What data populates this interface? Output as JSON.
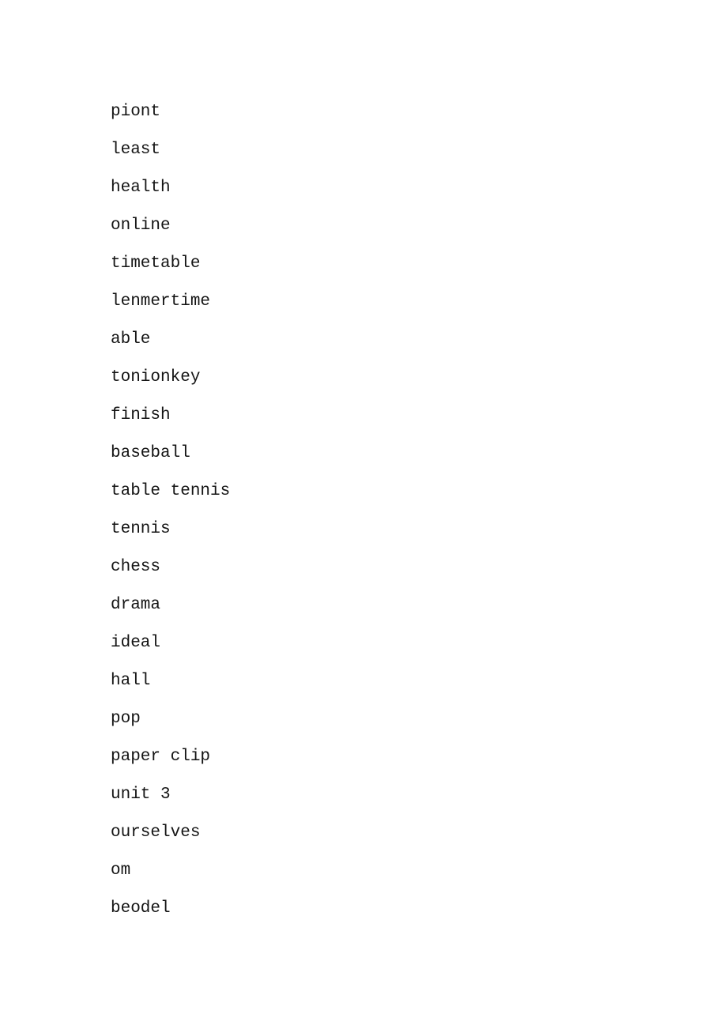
{
  "document": {
    "page_background": "#ffffff",
    "text_color": "#141414",
    "word_list": [
      {
        "text": "piont"
      },
      {
        "text": "least"
      },
      {
        "text": "health"
      },
      {
        "text": "online"
      },
      {
        "text": "timetable"
      },
      {
        "text": "lenmertime"
      },
      {
        "text": "able"
      },
      {
        "text": "tonionkey"
      },
      {
        "text": "finish"
      },
      {
        "text": "baseball"
      },
      {
        "text": "table tennis"
      },
      {
        "text": "tennis"
      },
      {
        "text": "chess"
      },
      {
        "text": "drama"
      },
      {
        "text": "ideal"
      },
      {
        "text": "hall"
      },
      {
        "text": "pop"
      },
      {
        "text": "paper clip"
      },
      {
        "text": "unit 3"
      },
      {
        "text": "ourselves"
      },
      {
        "text": "om"
      },
      {
        "text": "beodel"
      }
    ]
  }
}
